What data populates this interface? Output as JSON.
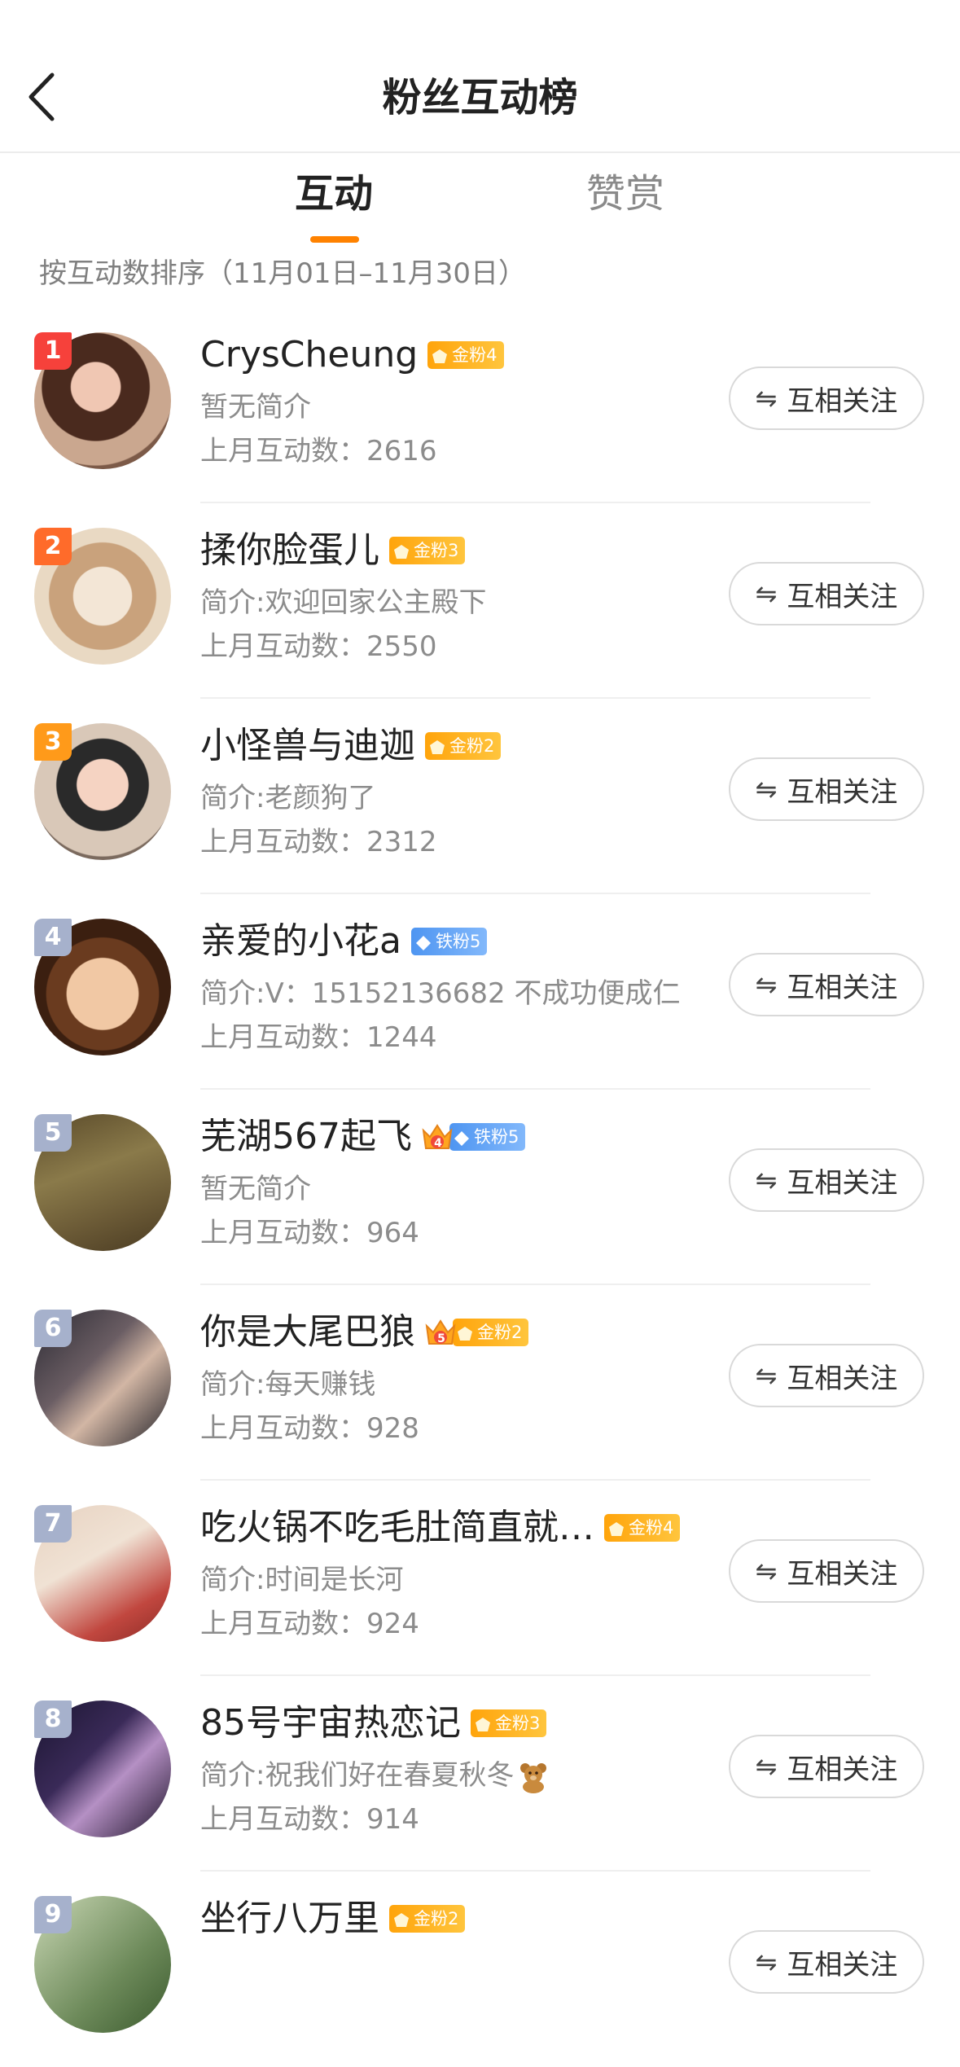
{
  "header": {
    "title": "粉丝互动榜",
    "back_icon": "chevron-left-icon"
  },
  "tabs": [
    {
      "label": "互动",
      "active": true
    },
    {
      "label": "赞赏",
      "active": false
    }
  ],
  "accent_color": "#ff8200",
  "sort_note": "按互动数排序（11月01日–11月30日）",
  "follow_label": "互相关注",
  "follow_icon": "⇋",
  "count_prefix": "上月互动数：",
  "rows": [
    {
      "rank": "1",
      "name": "CrysCheung",
      "badge": "金粉4",
      "badge_type": "gold",
      "intro": "暂无简介",
      "count": "2616",
      "rank_color": "#f6413b"
    },
    {
      "rank": "2",
      "name": "揉你脸蛋儿",
      "badge": "金粉3",
      "badge_type": "gold",
      "intro": "简介:欢迎回家公主殿下",
      "count": "2550",
      "rank_color": "#ff6b2a"
    },
    {
      "rank": "3",
      "name": "小怪兽与迪迦",
      "badge": "金粉2",
      "badge_type": "gold",
      "intro": "简介:老颜狗了",
      "count": "2312",
      "rank_color": "#ff9a1a"
    },
    {
      "rank": "4",
      "name": "亲爱的小花a",
      "badge": "铁粉5",
      "badge_type": "iron",
      "intro": "简介:V：15152136682 不成功便成仁",
      "count": "1244",
      "rank_color": "#a6b1cc"
    },
    {
      "rank": "5",
      "name": "芜湖567起飞",
      "badge": "铁粉5",
      "badge_type": "iron",
      "crown": "4",
      "intro": "暂无简介",
      "count": "964",
      "rank_color": "#a6b1cc"
    },
    {
      "rank": "6",
      "name": "你是大尾巴狼",
      "badge": "金粉2",
      "badge_type": "gold",
      "crown": "5",
      "intro": "简介:每天赚钱",
      "count": "928",
      "rank_color": "#a6b1cc"
    },
    {
      "rank": "7",
      "name": "吃火锅不吃毛肚简直就…",
      "badge": "金粉4",
      "badge_type": "gold",
      "intro": "简介:时间是长河",
      "count": "924",
      "rank_color": "#a6b1cc"
    },
    {
      "rank": "8",
      "name": "85号宇宙热恋记",
      "badge": "金粉3",
      "badge_type": "gold",
      "intro": "简介:祝我们好在春夏秋冬",
      "emoji": "teddy-bear-icon",
      "count": "914",
      "rank_color": "#a6b1cc"
    },
    {
      "rank": "9",
      "name": "坐行八万里",
      "badge": "金粉2",
      "badge_type": "gold",
      "intro": "",
      "count": "",
      "rank_color": "#a6b1cc"
    }
  ]
}
